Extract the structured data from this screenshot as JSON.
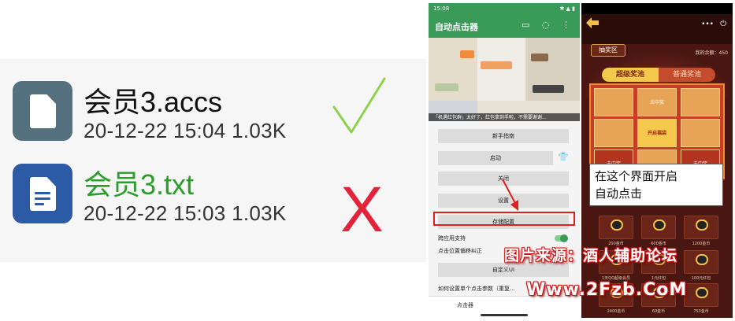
{
  "files": [
    {
      "name": "会员3.accs",
      "meta": "20-12-22 15:04  1.03K",
      "icon": "file-icon",
      "name_color": "#111111",
      "verdict": "check"
    },
    {
      "name": "会员3.txt",
      "meta": "20-12-22 15:03  1.03K",
      "icon": "document-icon",
      "name_color": "#2a9d2a",
      "verdict": "cross"
    }
  ],
  "cross_label": "X",
  "colors": {
    "check": "#8fd14f",
    "cross": "#e2243b",
    "app_green": "#3a9a58",
    "highlight": "#e02020"
  },
  "app": {
    "time": "15:08",
    "title": "自动点击器",
    "preview_notice": "「机遇红包群」太好了，红包拿到手啦，不需要谢谢...",
    "buttons": {
      "guide": "新手指南",
      "start": "启动",
      "close": "关闭",
      "settings": "设置",
      "save": "存储配置",
      "custom_ui": "自定义UI"
    },
    "cross_app_support": "跨应用支持",
    "offset_correction": "点击位置偏移纠正",
    "howto": "如何设置单个点击参数（重复...",
    "nav": {
      "clicker": "点击器"
    }
  },
  "game": {
    "lottery_tag": "抽奖区",
    "balance": "我的余额：450",
    "tab_super": "超级奖池",
    "tab_normal": "普通奖池",
    "cells": [
      "",
      "未中奖",
      "",
      "",
      "开启福袋",
      "",
      "未中奖",
      "",
      "未中奖"
    ],
    "caption_line1": "在这个界面开启",
    "caption_line2": "自动点击",
    "prize_labels": [
      "200金币",
      "600金币",
      "1200金币",
      "1天QQ超级会员",
      "1元红包",
      "100元红包",
      "2400金币",
      "60金币",
      "750金币"
    ]
  },
  "watermark": {
    "line1": "图片来源：酒人辅助论坛",
    "line2": "Www.2Fzb.CoM"
  }
}
